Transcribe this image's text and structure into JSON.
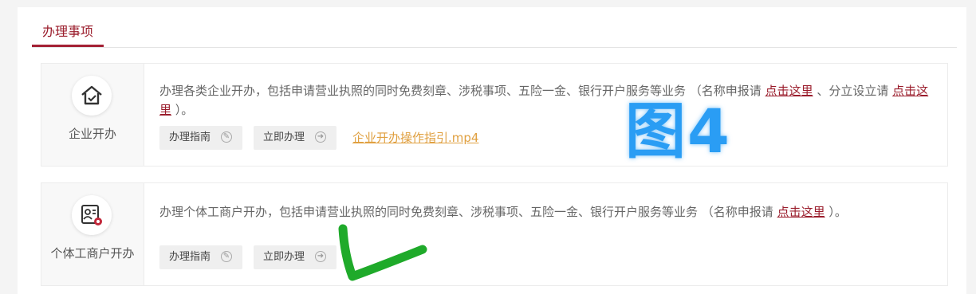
{
  "tabs": [
    {
      "label": "办理事项",
      "active": true
    }
  ],
  "cards": [
    {
      "name": "企业开办",
      "icon": "house-icon",
      "desc_part1": "办理各类企业开办，包括申请营业执照的同时免费刻章、涉税事项、五险一金、银行开户服务等业务 （名称申报请",
      "link1": "点击这里",
      "desc_part2": "、分立设立请",
      "link2": "点击这里",
      "desc_part3": "）。",
      "guide_label": "办理指南",
      "go_label": "立即办理",
      "video_link": "企业开办操作指引.mp4"
    },
    {
      "name": "个体工商户开办",
      "icon": "id-card-gear-icon",
      "desc_part1": "办理个体工商户开办，包括申请营业执照的同时免费刻章、涉税事项、五险一金、银行开户服务等业务 （名称申报请",
      "link1": "点击这里",
      "desc_part2": "）。",
      "guide_label": "办理指南",
      "go_label": "立即办理"
    }
  ],
  "annotation": {
    "text": "图4",
    "color": "#2a9df4"
  },
  "colors": {
    "accent": "#9a1c2b",
    "video_link": "#e0a040",
    "check_mark": "#1faa2a"
  }
}
